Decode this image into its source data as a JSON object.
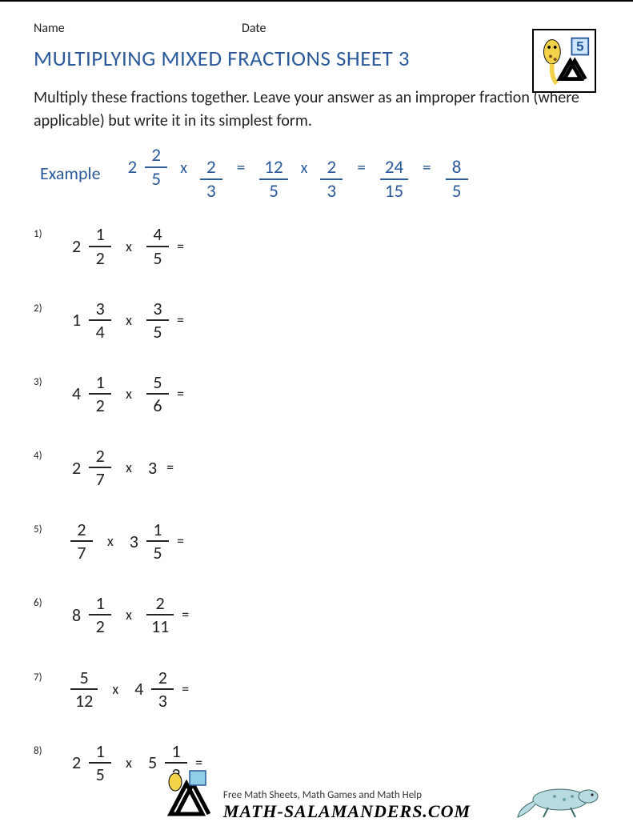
{
  "header": {
    "name_label": "Name",
    "date_label": "Date",
    "grade_badge": "5"
  },
  "title": "MULTIPLYING MIXED FRACTIONS SHEET 3",
  "instructions": "Multiply these fractions together. Leave your answer as an improper fraction (where applicable) but write it in its simplest form.",
  "example": {
    "label": "Example",
    "steps": [
      {
        "type": "mixed",
        "whole": "2",
        "num": "2",
        "den": "5"
      },
      {
        "type": "op",
        "text": "x"
      },
      {
        "type": "frac",
        "num": "2",
        "den": "3"
      },
      {
        "type": "eq",
        "text": "="
      },
      {
        "type": "frac",
        "num": "12",
        "den": "5"
      },
      {
        "type": "op",
        "text": "x"
      },
      {
        "type": "frac",
        "num": "2",
        "den": "3"
      },
      {
        "type": "eq",
        "text": "="
      },
      {
        "type": "frac",
        "num": "24",
        "den": "15"
      },
      {
        "type": "eq",
        "text": "="
      },
      {
        "type": "frac",
        "num": "8",
        "den": "5"
      }
    ]
  },
  "problems": [
    {
      "n": "1)",
      "a": {
        "type": "mixed",
        "whole": "2",
        "num": "1",
        "den": "2"
      },
      "b": {
        "type": "frac",
        "num": "4",
        "den": "5"
      }
    },
    {
      "n": "2)",
      "a": {
        "type": "mixed",
        "whole": "1",
        "num": "3",
        "den": "4"
      },
      "b": {
        "type": "frac",
        "num": "3",
        "den": "5"
      }
    },
    {
      "n": "3)",
      "a": {
        "type": "mixed",
        "whole": "4",
        "num": "1",
        "den": "2"
      },
      "b": {
        "type": "frac",
        "num": "5",
        "den": "6"
      }
    },
    {
      "n": "4)",
      "a": {
        "type": "mixed",
        "whole": "2",
        "num": "2",
        "den": "7"
      },
      "b": {
        "type": "whole",
        "whole": "3"
      }
    },
    {
      "n": "5)",
      "a": {
        "type": "frac",
        "num": "2",
        "den": "7"
      },
      "b": {
        "type": "mixed",
        "whole": "3",
        "num": "1",
        "den": "5"
      }
    },
    {
      "n": "6)",
      "a": {
        "type": "mixed",
        "whole": "8",
        "num": "1",
        "den": "2"
      },
      "b": {
        "type": "frac",
        "num": "2",
        "den": "11"
      }
    },
    {
      "n": "7)",
      "a": {
        "type": "frac",
        "num": "5",
        "den": "12"
      },
      "b": {
        "type": "mixed",
        "whole": "4",
        "num": "2",
        "den": "3"
      }
    },
    {
      "n": "8)",
      "a": {
        "type": "mixed",
        "whole": "2",
        "num": "1",
        "den": "5"
      },
      "b": {
        "type": "mixed",
        "whole": "5",
        "num": "1",
        "den": "2"
      }
    }
  ],
  "operator": "x",
  "equals": "=",
  "footer": {
    "tagline": "Free Math Sheets, Math Games and Math Help",
    "site": "MATH-SALAMANDERS.COM"
  }
}
